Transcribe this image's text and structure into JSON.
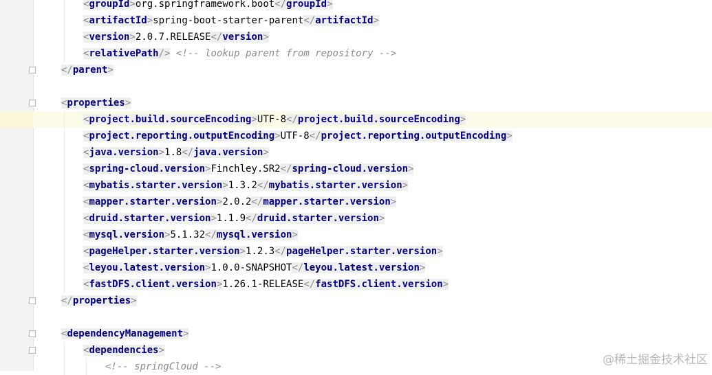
{
  "lines": [
    {
      "indent": 1,
      "kind": "elem",
      "tag": "groupId",
      "value": "org.springframework.boot"
    },
    {
      "indent": 1,
      "kind": "elem",
      "tag": "artifactId",
      "value": "spring-boot-starter-parent"
    },
    {
      "indent": 1,
      "kind": "elem",
      "tag": "version",
      "value": "2.0.7.RELEASE"
    },
    {
      "indent": 1,
      "kind": "selfclose",
      "tag": "relativePath",
      "comment": "<!-- lookup parent from repository -->"
    },
    {
      "indent": 0,
      "kind": "close",
      "tag": "parent",
      "fold": "end"
    },
    {
      "indent": 0,
      "kind": "blank"
    },
    {
      "indent": 0,
      "kind": "open",
      "tag": "properties",
      "fold": "start"
    },
    {
      "indent": 1,
      "kind": "elem",
      "tag": "project.build.sourceEncoding",
      "value": "UTF-8",
      "current": true
    },
    {
      "indent": 1,
      "kind": "elem",
      "tag": "project.reporting.outputEncoding",
      "value": "UTF-8"
    },
    {
      "indent": 1,
      "kind": "elem",
      "tag": "java.version",
      "value": "1.8"
    },
    {
      "indent": 1,
      "kind": "elem",
      "tag": "spring-cloud.version",
      "value": "Finchley.SR2"
    },
    {
      "indent": 1,
      "kind": "elem",
      "tag": "mybatis.starter.version",
      "value": "1.3.2"
    },
    {
      "indent": 1,
      "kind": "elem",
      "tag": "mapper.starter.version",
      "value": "2.0.2"
    },
    {
      "indent": 1,
      "kind": "elem",
      "tag": "druid.starter.version",
      "value": "1.1.9"
    },
    {
      "indent": 1,
      "kind": "elem",
      "tag": "mysql.version",
      "value": "5.1.32"
    },
    {
      "indent": 1,
      "kind": "elem",
      "tag": "pageHelper.starter.version",
      "value": "1.2.3"
    },
    {
      "indent": 1,
      "kind": "elem",
      "tag": "leyou.latest.version",
      "value": "1.0.0-SNAPSHOT"
    },
    {
      "indent": 1,
      "kind": "elem",
      "tag": "fastDFS.client.version",
      "value": "1.26.1-RELEASE"
    },
    {
      "indent": 0,
      "kind": "close",
      "tag": "properties",
      "fold": "end"
    },
    {
      "indent": 0,
      "kind": "blank"
    },
    {
      "indent": 0,
      "kind": "open",
      "tag": "dependencyManagement",
      "fold": "start"
    },
    {
      "indent": 1,
      "kind": "open",
      "tag": "dependencies",
      "fold": "start"
    },
    {
      "indent": 2,
      "kind": "comment",
      "comment": "<!-- springCloud -->"
    }
  ],
  "watermark": "@稀土掘金技术社区",
  "colors": {
    "tag_name": "#000080",
    "bracket": "#8a8a8a",
    "comment": "#8c8c8c",
    "current_line": "#fcfbe8",
    "gutter": "#f3f3f3"
  }
}
